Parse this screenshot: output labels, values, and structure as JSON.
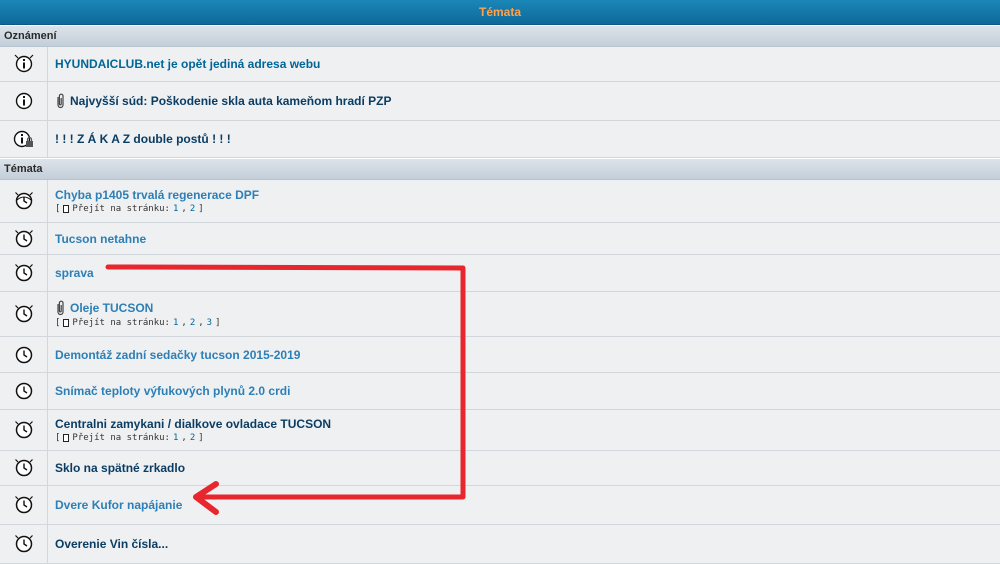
{
  "header": {
    "title": "Témata"
  },
  "announcements": {
    "label": "Oznámení",
    "items": [
      {
        "title": "HYUNDAICLUB.net je opět jediná adresa webu",
        "icon": "announce-icon",
        "attachment": false
      },
      {
        "title": "Najvyšší súd: Poškodenie skla auta kameňom hradí PZP",
        "icon": "announce-icon",
        "attachment": true
      },
      {
        "title": "! ! ! Z Á K A Z double postů ! ! !",
        "icon": "announce-locked-icon",
        "attachment": false
      }
    ]
  },
  "topics": {
    "label": "Témata",
    "goto_label": "Přejít na stránku:",
    "items": [
      {
        "title": "Chyba p1405 trvalá regenerace DPF",
        "attachment": false,
        "pages": [
          "1",
          "2"
        ]
      },
      {
        "title": "Tucson netahne",
        "attachment": false,
        "pages": []
      },
      {
        "title": "sprava",
        "attachment": false,
        "pages": []
      },
      {
        "title": "Oleje TUCSON",
        "attachment": true,
        "pages": [
          "1",
          "2",
          "3"
        ]
      },
      {
        "title": "Demontáž zadní sedačky tucson 2015-2019",
        "attachment": false,
        "pages": []
      },
      {
        "title": "Snímač teploty výfukových plynů 2.0 crdi",
        "attachment": false,
        "pages": []
      },
      {
        "title": "Centralni zamykani / dialkove ovladace TUCSON",
        "attachment": false,
        "pages": [
          "1",
          "2"
        ]
      },
      {
        "title": "Sklo na spätné zrkadlo",
        "attachment": false,
        "pages": []
      },
      {
        "title": "Dvere Kufor napájanie",
        "attachment": false,
        "pages": []
      },
      {
        "title": "Overenie Vin čísla...",
        "attachment": false,
        "pages": []
      }
    ]
  },
  "colors": {
    "header_text": "#ffa34f",
    "link": "#006597",
    "arrow": "#e8262d"
  }
}
